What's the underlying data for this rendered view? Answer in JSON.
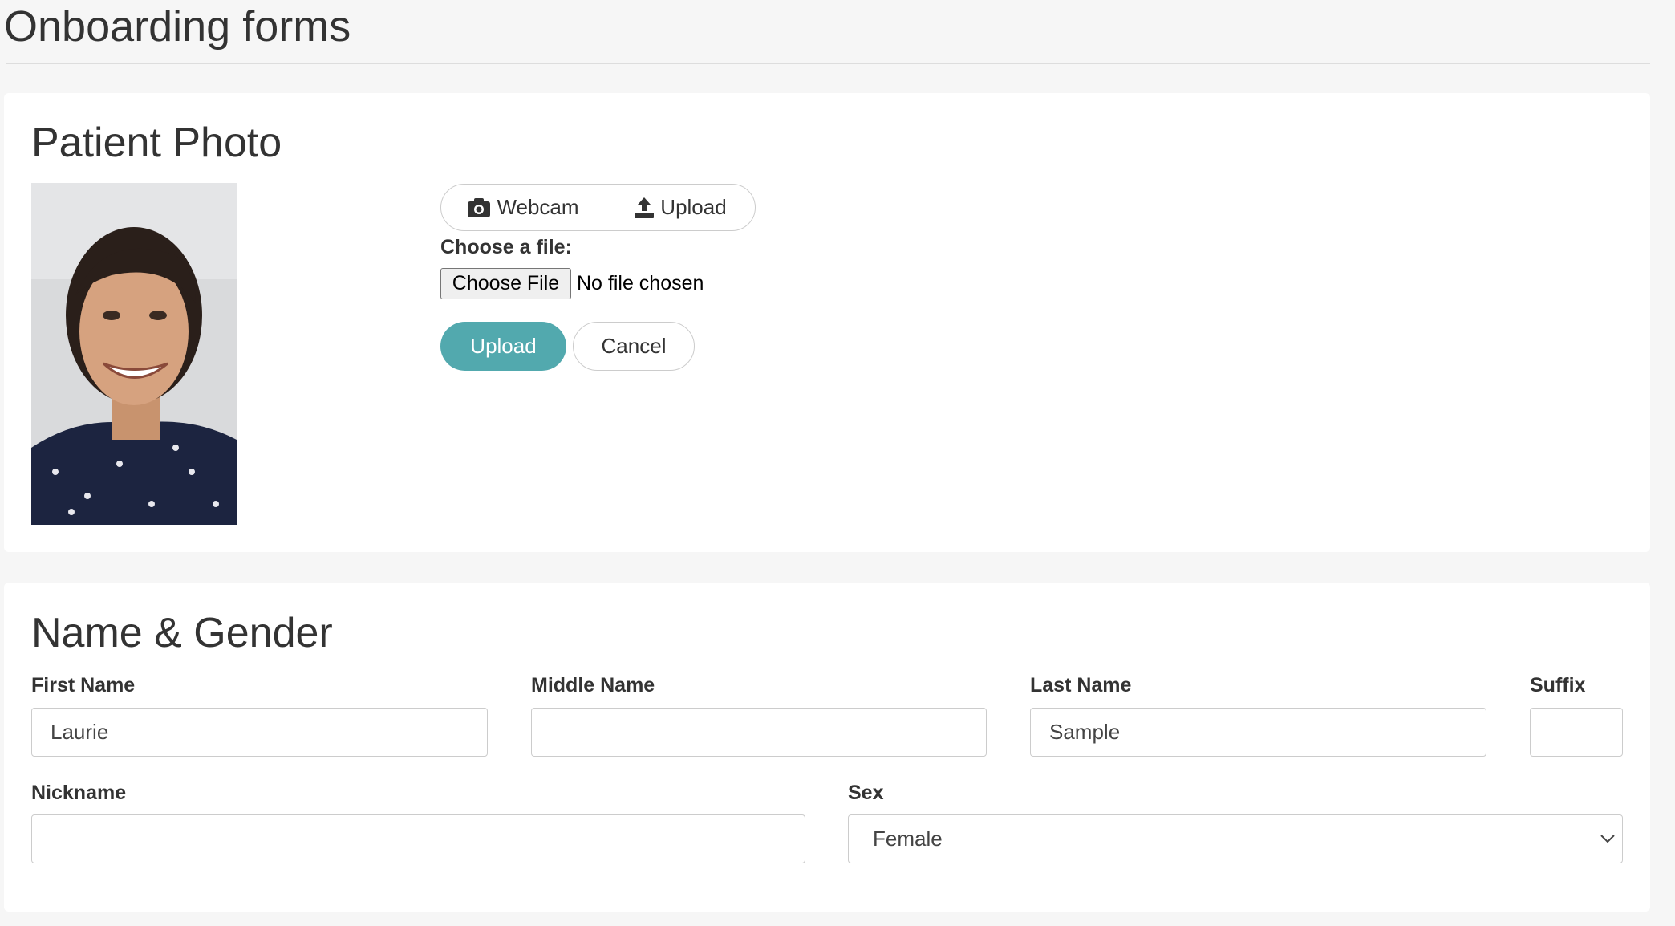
{
  "page": {
    "title": "Onboarding forms"
  },
  "photo_section": {
    "title": "Patient Photo",
    "webcam_label": "Webcam",
    "upload_tab_label": "Upload",
    "choose_label": "Choose a file:",
    "choose_file_button": "Choose File",
    "no_file_text": "No file chosen",
    "upload_button": "Upload",
    "cancel_button": "Cancel",
    "accent_color": "#52a9ae"
  },
  "name_section": {
    "title": "Name & Gender",
    "first_name": {
      "label": "First Name",
      "value": "Laurie"
    },
    "middle_name": {
      "label": "Middle Name",
      "value": ""
    },
    "last_name": {
      "label": "Last Name",
      "value": "Sample"
    },
    "suffix": {
      "label": "Suffix",
      "value": ""
    },
    "nickname": {
      "label": "Nickname",
      "value": ""
    },
    "sex": {
      "label": "Sex",
      "value": "Female"
    }
  }
}
